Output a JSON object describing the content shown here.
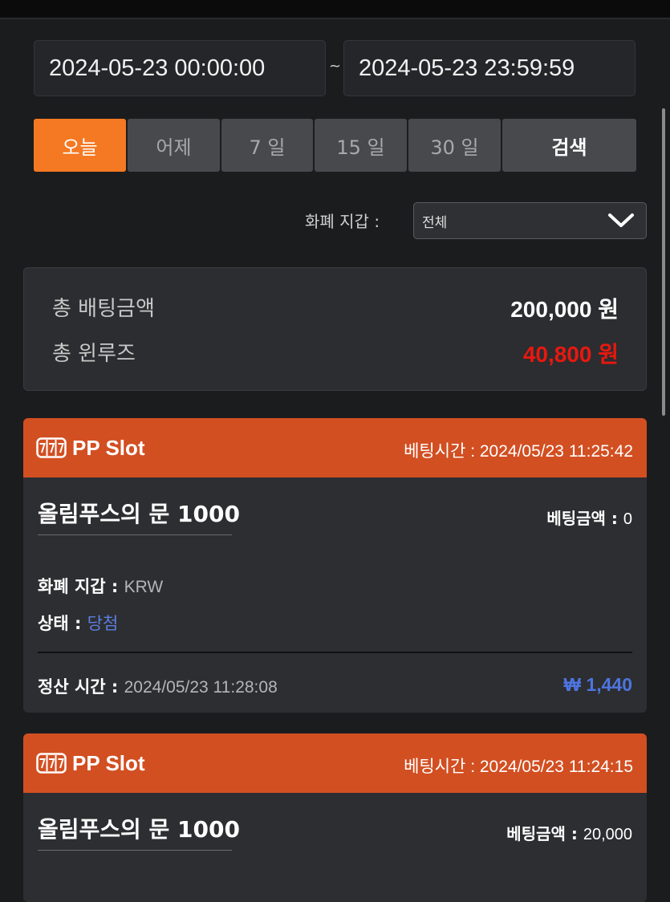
{
  "date_range": {
    "start": "2024-05-23 00:00:00",
    "separator": "~",
    "end": "2024-05-23 23:59:59"
  },
  "period_buttons": [
    "오늘",
    "어제",
    "7 일",
    "15 일",
    "30 일"
  ],
  "search_label": "검색",
  "currency_filter": {
    "label": "화폐 지갑 :",
    "selected": "전체"
  },
  "summary": {
    "total_bet_label": "총 배팅금액",
    "total_bet_value": "200,000 원",
    "total_winloss_label": "총 윈루즈",
    "total_winloss_value": "40,800 원"
  },
  "cards": [
    {
      "provider": "PP Slot",
      "bet_time": "베팅시간 : 2024/05/23 11:25:42",
      "game": "올림푸스의 문 1000",
      "bet_amount_label": "베팅금액 : ",
      "bet_amount": "0",
      "currency_label": "화폐 지갑 : ",
      "currency": "KRW",
      "status_label": "상태 : ",
      "status": "당첨",
      "settle_label": "정산 시간 : ",
      "settle_time": "2024/05/23 11:28:08",
      "payout": "₩ 1,440"
    },
    {
      "provider": "PP Slot",
      "bet_time": "베팅시간 : 2024/05/23 11:24:15",
      "game": "올림푸스의 문 1000",
      "bet_amount_label": "베팅금액 : ",
      "bet_amount": "20,000"
    }
  ],
  "colors": {
    "accent": "#f47922",
    "card_header": "#d24f22",
    "winloss": "#e8180f",
    "status_blue": "#5b7fe0"
  }
}
